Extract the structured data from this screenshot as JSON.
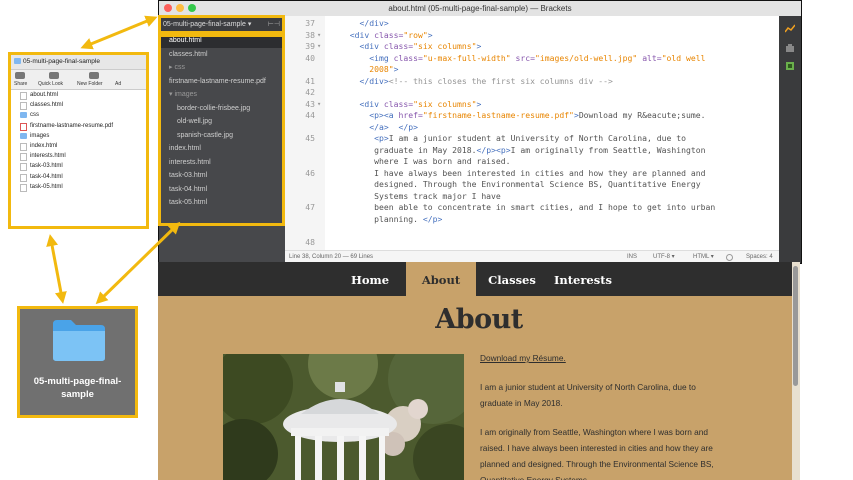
{
  "window": {
    "title": "about.html (05-multi-page-final-sample) — Brackets"
  },
  "sidebar": {
    "project": "05-multi-page-final-sample",
    "project_caret": "▾",
    "split_icon": "⊢⊣",
    "items": [
      {
        "label": "about.html",
        "indent": 0,
        "selected": true,
        "folder": false
      },
      {
        "label": "classes.html",
        "indent": 0,
        "selected": false,
        "folder": false
      },
      {
        "label": "▸ css",
        "indent": 0,
        "selected": false,
        "folder": true
      },
      {
        "label": "firstname-lastname-resume.pdf",
        "indent": 0,
        "selected": false,
        "folder": false
      },
      {
        "label": "▾ images",
        "indent": 0,
        "selected": false,
        "folder": true
      },
      {
        "label": "border-collie-frisbee.jpg",
        "indent": 1,
        "selected": false,
        "folder": false
      },
      {
        "label": "old-well.jpg",
        "indent": 1,
        "selected": false,
        "folder": false
      },
      {
        "label": "spanish-castle.jpg",
        "indent": 1,
        "selected": false,
        "folder": false
      },
      {
        "label": "index.html",
        "indent": 0,
        "selected": false,
        "folder": false
      },
      {
        "label": "interests.html",
        "indent": 0,
        "selected": false,
        "folder": false
      },
      {
        "label": "task-03.html",
        "indent": 0,
        "selected": false,
        "folder": false
      },
      {
        "label": "task-04.html",
        "indent": 0,
        "selected": false,
        "folder": false
      },
      {
        "label": "task-05.html",
        "indent": 0,
        "selected": false,
        "folder": false
      }
    ]
  },
  "editor": {
    "lines": [
      {
        "num": "37",
        "fold": "",
        "html": "    <span class=\"tg\">&lt;/div&gt;</span>"
      },
      {
        "num": "38",
        "fold": "▾",
        "html": "  <span class=\"tg\">&lt;div</span> <span class=\"at\">class=</span><span class=\"st\">\"row\"</span><span class=\"tg\">&gt;</span>"
      },
      {
        "num": "39",
        "fold": "▾",
        "html": "    <span class=\"tg\">&lt;div</span> <span class=\"at\">class=</span><span class=\"st\">\"six columns\"</span><span class=\"tg\">&gt;</span>"
      },
      {
        "num": "40",
        "fold": "",
        "html": "      <span class=\"tg\">&lt;img</span> <span class=\"at\">class=</span><span class=\"st\">\"u-max-full-width\"</span> <span class=\"at\">src=</span><span class=\"st\">\"images/old-well.jpg\"</span> <span class=\"at\">alt=</span><span class=\"st\">\"old well</span>"
      },
      {
        "num": "",
        "fold": "",
        "html": "      <span class=\"st\">2008\"</span><span class=\"tg\">&gt;</span>"
      },
      {
        "num": "41",
        "fold": "",
        "html": "    <span class=\"tg\">&lt;/div&gt;</span><span class=\"cm\">&lt;!-- this closes the first six columns div --&gt;</span>"
      },
      {
        "num": "42",
        "fold": "",
        "html": ""
      },
      {
        "num": "43",
        "fold": "▾",
        "html": "    <span class=\"tg\">&lt;div</span> <span class=\"at\">class=</span><span class=\"st\">\"six columns\"</span><span class=\"tg\">&gt;</span>"
      },
      {
        "num": "44",
        "fold": "",
        "html": "      <span class=\"tg\">&lt;p&gt;&lt;a</span> <span class=\"at\">href=</span><span class=\"st\">\"firstname-lastname-resume.pdf\"</span><span class=\"tg\">&gt;</span>Download my R&amp;eacute;sume."
      },
      {
        "num": "",
        "fold": "",
        "html": "      <span class=\"tg\">&lt;/a&gt;</span>  <span class=\"tg\">&lt;/p&gt;</span>"
      },
      {
        "num": "45",
        "fold": "",
        "html": "       <span class=\"tg\">&lt;p&gt;</span>I am a junior student at University of North Carolina, due to"
      },
      {
        "num": "",
        "fold": "",
        "html": "       graduate in May 2018.<span class=\"tg\">&lt;/p&gt;&lt;p&gt;</span>I am originally from Seattle, Washington"
      },
      {
        "num": "",
        "fold": "",
        "html": "       where I was born and raised."
      },
      {
        "num": "46",
        "fold": "",
        "html": "       I have always been interested in cities and how they are planned and"
      },
      {
        "num": "",
        "fold": "",
        "html": "       designed. Through the Environmental Science BS, Quantitative Energy"
      },
      {
        "num": "",
        "fold": "",
        "html": "       Systems track major I have"
      },
      {
        "num": "47",
        "fold": "",
        "html": "       been able to concentrate in smart cities, and I hope to get into urban"
      },
      {
        "num": "",
        "fold": "",
        "html": "       planning. <span class=\"tg\">&lt;/p&gt;</span>"
      },
      {
        "num": "",
        "fold": "",
        "html": ""
      },
      {
        "num": "48",
        "fold": "",
        "html": ""
      }
    ]
  },
  "statusbar": {
    "position": "Line 38, Column 20 — 69 Lines",
    "mode": "INS",
    "encoding": "UTF-8 ▾",
    "language": "HTML ▾",
    "spaces": "Spaces: 4"
  },
  "browser": {
    "nav": [
      "Home",
      "About",
      "Classes",
      "Interests"
    ],
    "active_nav": "About",
    "title": "About",
    "download_link": "Download my Résume.",
    "paragraph1": "I am a junior student at University of North Carolina, due to graduate in May 2018.",
    "paragraph2": "I am originally from Seattle, Washington where I was born and raised. I have always been interested in cities and how they are planned and designed. Through the Environmental Science BS, Quantitative Energy Systems"
  },
  "finder": {
    "title": "05-multi-page-final-sample",
    "toolbar": [
      "Share",
      "Quick Look",
      "New Folder",
      "Ad"
    ],
    "items": [
      {
        "label": "about.html",
        "type": "doc"
      },
      {
        "label": "classes.html",
        "type": "doc"
      },
      {
        "label": "css",
        "type": "folder"
      },
      {
        "label": "firstname-lastname-resume.pdf",
        "type": "pdf"
      },
      {
        "label": "images",
        "type": "folder"
      },
      {
        "label": "index.html",
        "type": "doc"
      },
      {
        "label": "interests.html",
        "type": "doc"
      },
      {
        "label": "task-03.html",
        "type": "doc"
      },
      {
        "label": "task-04.html",
        "type": "doc"
      },
      {
        "label": "task-05.html",
        "type": "doc"
      }
    ]
  },
  "folder_tile": {
    "label": "05-multi-page-final-sample"
  },
  "colors": {
    "highlight": "#f2b90f",
    "page_bg": "#c8a26a",
    "nav_bg": "#2e2e2e"
  }
}
